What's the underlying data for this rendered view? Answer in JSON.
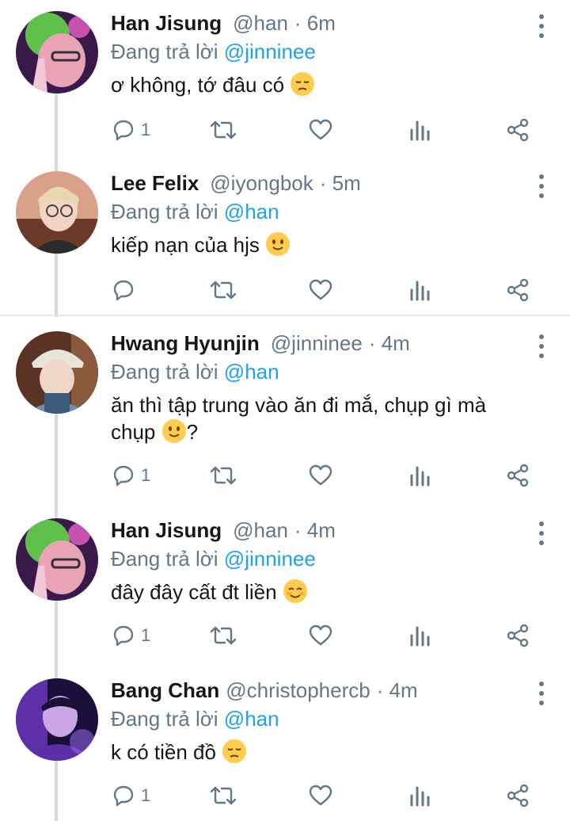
{
  "reply_prefix": "Đang trả lời",
  "colors": {
    "accent": "#1da1f2",
    "secondary_text": "#657786",
    "thread_line": "#d5dbe0"
  },
  "tweets": [
    {
      "name": "Han Jisung",
      "handle": "@han",
      "time": "· 6m",
      "reply_to": "@jinninee",
      "text": "ơ không, tớ đâu có",
      "emoji": "pensive-face",
      "reply_count": "1",
      "avatar": "han-jisung-avatar"
    },
    {
      "name": "Lee Felix",
      "handle": "@iyongbok",
      "time": "· 5m",
      "reply_to": "@han",
      "text": "kiếp nạn của hjs",
      "emoji": "slightly-smiling-face",
      "reply_count": "",
      "avatar": "lee-felix-avatar"
    },
    {
      "name": "Hwang Hyunjin",
      "handle": "@jinninee",
      "time": "· 4m",
      "reply_to": "@han",
      "text_line1": "ăn thì tập trung vào ăn đi mắ, chụp gì mà",
      "text_line2": "chụp",
      "text_suffix": "?",
      "emoji": "slightly-smiling-face",
      "reply_count": "1",
      "avatar": "hwang-hyunjin-avatar"
    },
    {
      "name": "Han Jisung",
      "handle": "@han",
      "time": "· 4m",
      "reply_to": "@jinninee",
      "text": "đây đây cất đt liền",
      "emoji": "smiling-face",
      "reply_count": "1",
      "avatar": "han-jisung-avatar"
    },
    {
      "name": "Bang Chan",
      "handle": "@christophercb",
      "time": "· 4m",
      "reply_to": "@han",
      "text": "k có tiền đồ",
      "emoji": "pensive-face",
      "reply_count": "1",
      "avatar": "bang-chan-avatar"
    }
  ]
}
